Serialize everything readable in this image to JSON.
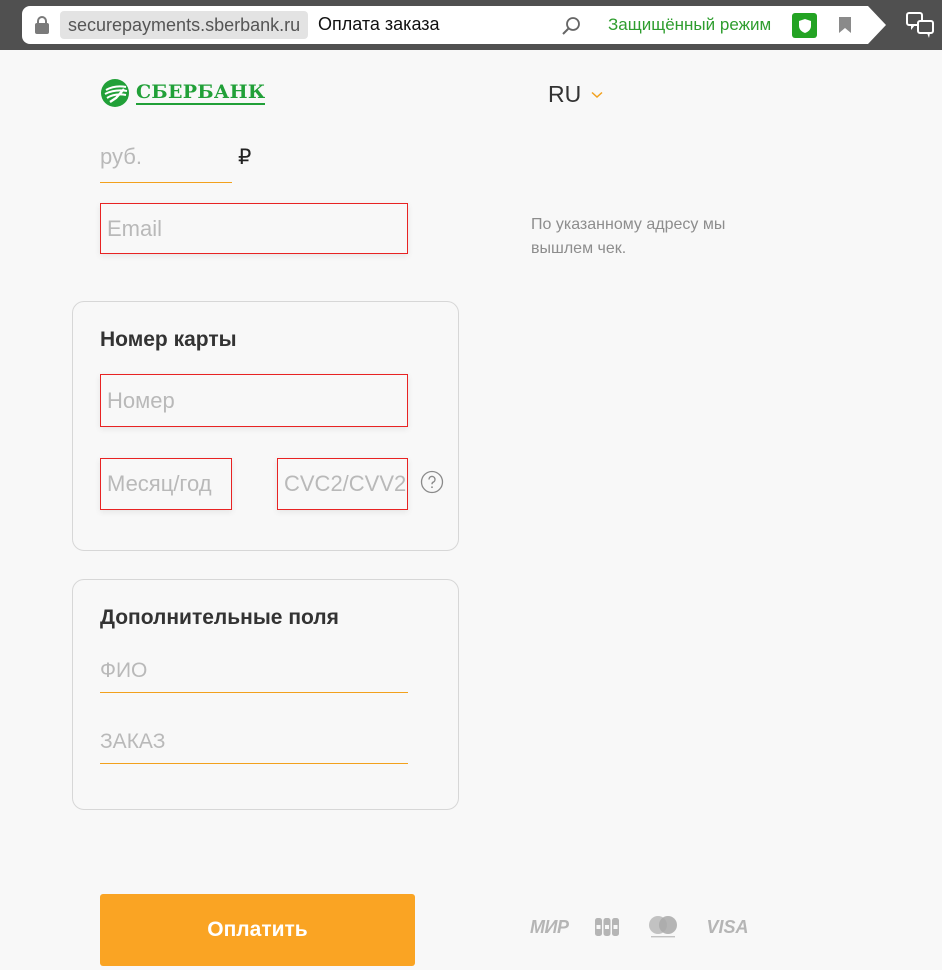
{
  "browser": {
    "domain": "securepayments.sberbank.ru",
    "title": "Оплата заказа",
    "secure_mode": "Защищённый режим"
  },
  "header": {
    "logo_text": "СБЕРБАНК",
    "language": "RU"
  },
  "amount": {
    "placeholder": "руб.",
    "currency_symbol": "₽"
  },
  "email": {
    "placeholder": "Email",
    "hint": "По указанному адресу мы вышлем чек."
  },
  "card": {
    "title": "Номер карты",
    "number_placeholder": "Номер",
    "expiry_placeholder": "Месяц/год",
    "cvc_placeholder": "CVC2/CVV2"
  },
  "extra": {
    "title": "Дополнительные поля",
    "fio_placeholder": "ФИО",
    "order_placeholder": "ЗАКАЗ"
  },
  "pay_button": "Оплатить",
  "payment_systems": {
    "mir": "МИР",
    "visa": "VISA",
    "icons": [
      "mir-logo",
      "jcb-logo",
      "mastercard-logo",
      "visa-logo"
    ]
  },
  "colors": {
    "brand_green": "#21a038",
    "accent_orange": "#faa423",
    "error_red": "#e82323",
    "secure_green": "#2e9d2e"
  }
}
